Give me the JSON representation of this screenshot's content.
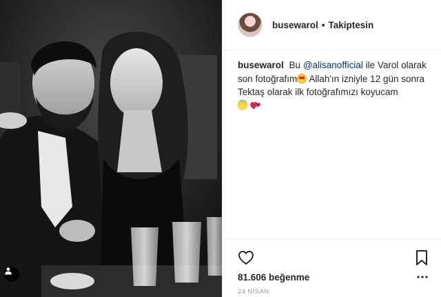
{
  "post": {
    "username": "busewarol",
    "header_separator": "•",
    "follow_status": "Takiptesin",
    "caption": {
      "username": "busewarol",
      "text_before": "Bu",
      "mention": "@alisanofficial",
      "text_after_mention": "ile Varol olarak son fotoğrafım",
      "text_line_2": "Allah'ın izniyle 12 gün sonra Tektaş olarak ilk fotoğrafımızı koyucam"
    },
    "likes": "81.606 beğenme",
    "date": "24 NİSAN"
  },
  "icons": {
    "avatar": "profile-avatar",
    "tag": "person-tag-icon",
    "like": "heart-outline-icon",
    "save": "bookmark-icon",
    "more": "more-dots-icon",
    "emoji_1": "smiling-face-with-heart-eyes",
    "emoji_2": "smiling-face-with-halo",
    "emoji_3": "two-hearts"
  },
  "colors": {
    "text": "#262626",
    "mention": "#003569",
    "muted": "#999999",
    "border": "#efefef"
  }
}
